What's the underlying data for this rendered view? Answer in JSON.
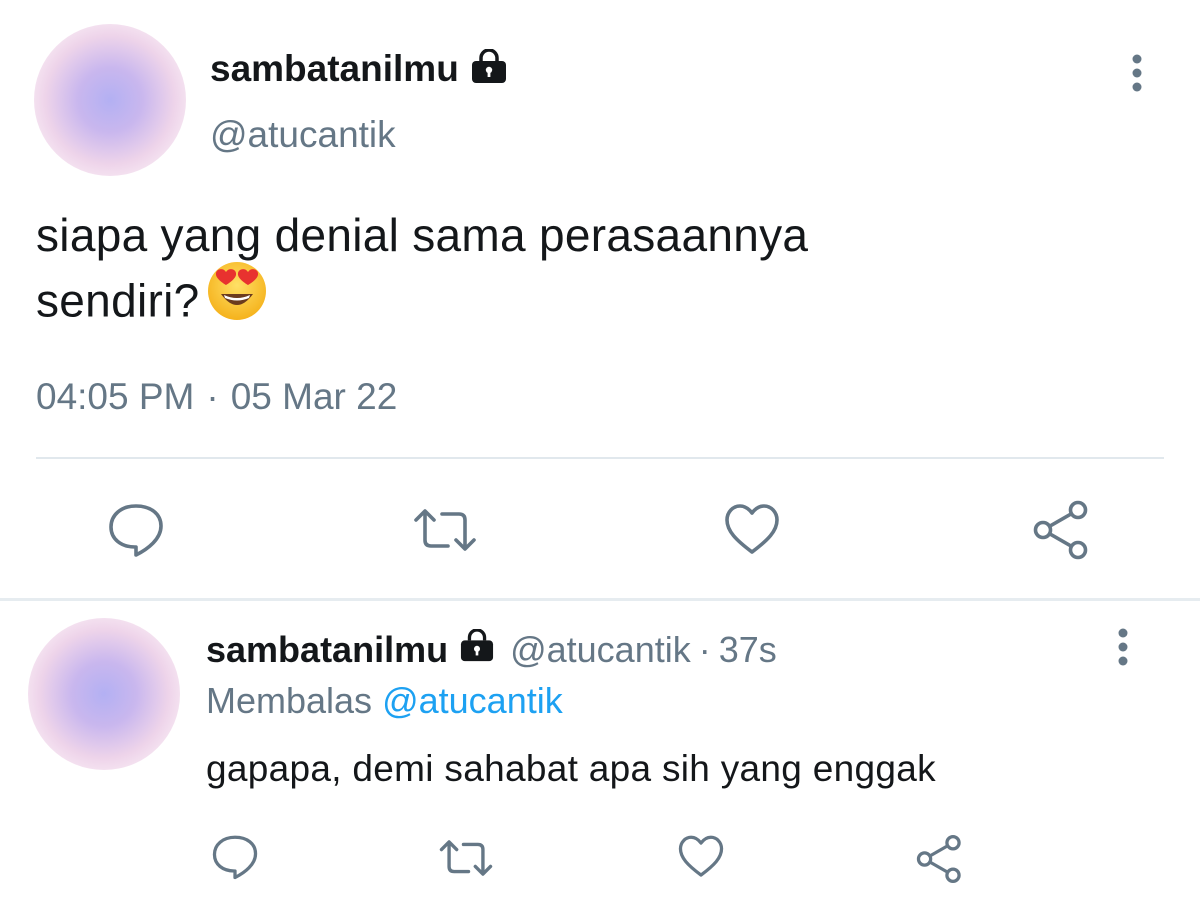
{
  "main_tweet": {
    "display_name": "sambatanilmu",
    "handle": "@atucantik",
    "text_line1": "siapa yang denial sama perasaannya",
    "text_line2": "sendiri?",
    "emoji": "smiling-face-with-heart-eyes",
    "time": "04:05 PM",
    "separator": "·",
    "date": "05 Mar 22"
  },
  "reply_tweet": {
    "display_name": "sambatanilmu",
    "handle": "@atucantik",
    "separator": "·",
    "time": "37s",
    "replying_label": "Membalas",
    "replying_to": "@atucantik",
    "text": "gapapa, demi sahabat apa sih yang enggak"
  },
  "icons": {
    "lock": "lock-icon",
    "more": "more-vertical-icon",
    "reply": "reply-icon",
    "retweet": "retweet-icon",
    "like": "heart-icon",
    "share": "share-icon"
  },
  "colors": {
    "text": "#14171a",
    "secondary": "#657786",
    "accent": "#1da1f2",
    "divider": "#e1e8ed"
  }
}
